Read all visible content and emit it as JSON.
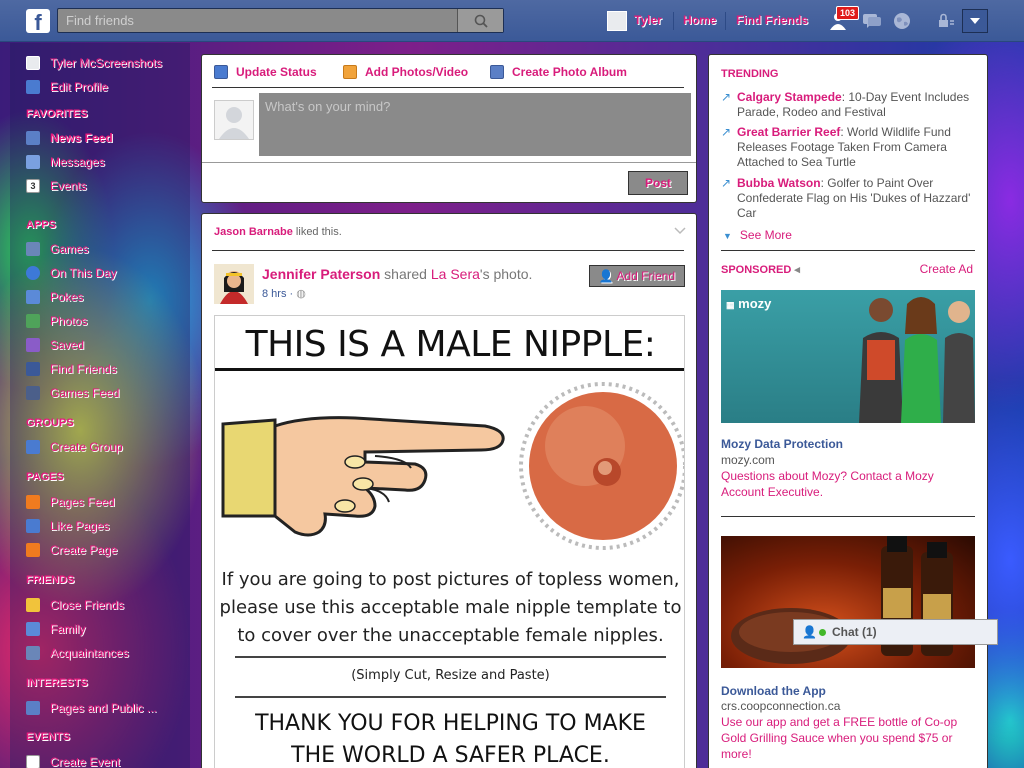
{
  "topbar": {
    "logo_letter": "f",
    "search_placeholder": "Find friends",
    "user_name": "Tyler",
    "home": "Home",
    "find_friends": "Find Friends",
    "notification_badge": "103",
    "colors": {
      "bar": "#3b5998",
      "link": "#d81c7b"
    }
  },
  "leftnav": {
    "profile_name": "Tyler McScreenshots",
    "edit_profile": "Edit Profile",
    "favorites_head": "FAVORITES",
    "favorites": [
      "News Feed",
      "Messages",
      "Events"
    ],
    "apps_head": "APPS",
    "apps": [
      "Games",
      "On This Day",
      "Pokes",
      "Photos",
      "Saved",
      "Find Friends",
      "Games Feed"
    ],
    "groups_head": "GROUPS",
    "groups": [
      "Create Group"
    ],
    "pages_head": "PAGES",
    "pages": [
      "Pages Feed",
      "Like Pages",
      "Create Page"
    ],
    "friends_head": "FRIENDS",
    "friends": [
      "Close Friends",
      "Family",
      "Acquaintances"
    ],
    "interests_head": "INTERESTS",
    "interests": [
      "Pages and Public ..."
    ],
    "events_head": "EVENTS",
    "events": [
      "Create Event"
    ],
    "events_date_icon": "3"
  },
  "composer": {
    "update_status": "Update Status",
    "add_photos": "Add Photos/Video",
    "create_album": "Create Photo Album",
    "placeholder": "What's on your mind?",
    "post": "Post"
  },
  "story": {
    "context_name": "Jason Barnabe",
    "context_action": " liked this.",
    "author": "Jennifer Paterson",
    "shared_text": " shared ",
    "page_name": "La Sera",
    "photo_suffix": "'s photo.",
    "time": "8 hrs",
    "add_friend": "Add Friend",
    "meme_title": "THIS IS A MALE NIPPLE:",
    "meme_line1": "If you are going to post pictures of topless women,",
    "meme_line2": "please use this acceptable male nipple template to",
    "meme_line3": "to cover over the unacceptable female nipples.",
    "meme_small": "(Simply Cut, Resize and Paste)",
    "meme_line4": "THANK YOU FOR HELPING TO MAKE",
    "meme_line5": "THE WORLD A SAFER PLACE."
  },
  "trending": {
    "head": "TRENDING",
    "items": [
      {
        "topic": "Calgary Stampede",
        "desc": ": 10-Day Event Includes Parade, Rodeo and Festival"
      },
      {
        "topic": "Great Barrier Reef",
        "desc": ": World Wildlife Fund Releases Footage Taken From Camera Attached to Sea Turtle"
      },
      {
        "topic": "Bubba Watson",
        "desc": ": Golfer to Paint Over Confederate Flag on His 'Dukes of Hazzard' Car"
      }
    ],
    "see_more": "See More"
  },
  "sponsored": {
    "head": "SPONSORED",
    "create_ad": "Create Ad",
    "ad1": {
      "logo": "mozy",
      "title": "Mozy Data Protection",
      "url": "mozy.com",
      "body": "Questions about Mozy? Contact a Mozy Account Executive."
    },
    "ad2": {
      "title": "Download the App",
      "url": "crs.coopconnection.ca",
      "body": "Use our app and get a FREE bottle of Co-op Gold Grilling Sauce when you spend $75 or more!"
    }
  },
  "chat": {
    "label": "Chat (1)"
  }
}
